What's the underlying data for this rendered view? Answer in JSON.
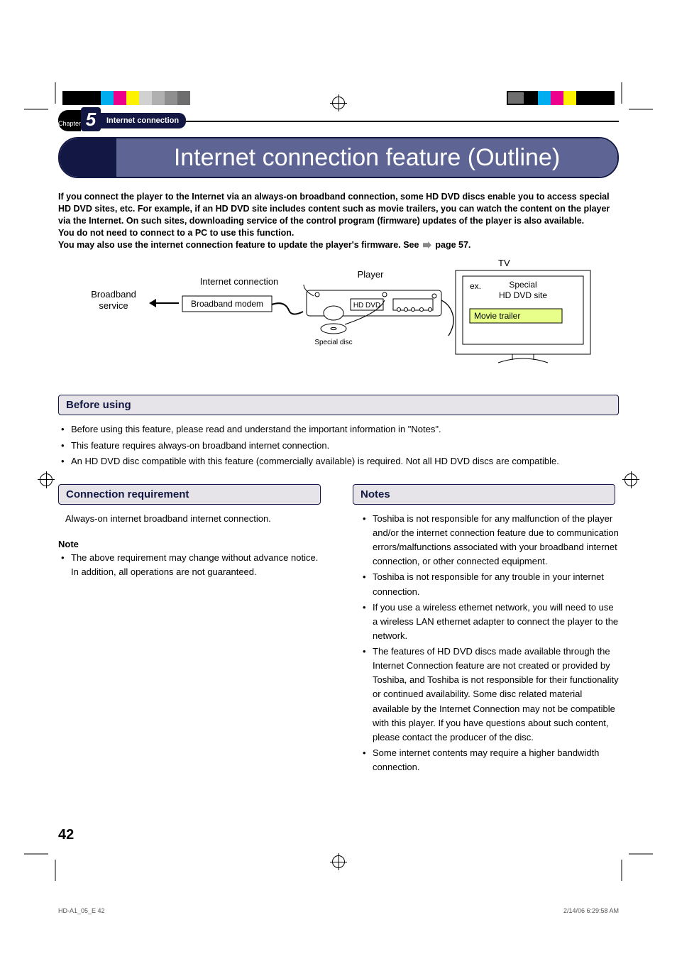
{
  "chapter": {
    "label_prefix": "Chapter",
    "number": "5",
    "section": "Internet connection"
  },
  "title": "Internet connection feature (Outline)",
  "intro": {
    "p1": "If you connect the player to the Internet via an always-on broadband connection, some HD DVD discs enable you to access special HD DVD sites, etc. For example, if an HD DVD site includes content such as movie trailers, you can watch the content on the player via the Internet. On such sites, downloading service of the control program (firmware) updates of the player is also available.",
    "p2": "You do not need to connect to a PC to use this function.",
    "p3_a": "You may also use the internet connection feature to update the player's firmware. See ",
    "p3_b": " page 57."
  },
  "diagram": {
    "broadband_service": "Broadband\nservice",
    "internet_connection": "Internet connection",
    "broadband_modem": "Broadband modem",
    "player": "Player",
    "hd_dvd": "HD DVD",
    "special_disc": "Special disc",
    "tv": "TV",
    "ex": "ex.",
    "special_site": "Special\nHD DVD site",
    "movie_trailer": "Movie trailer"
  },
  "before_using": {
    "heading": "Before using",
    "items": [
      "Before using this feature, please read and understand the important information in \"Notes\".",
      "This feature requires always-on broadband internet connection.",
      "An HD DVD disc compatible with this feature (commercially available) is required. Not all HD DVD discs are compatible."
    ]
  },
  "conn_req": {
    "heading": "Connection requirement",
    "body": "Always-on internet broadband internet connection.",
    "note_label": "Note",
    "note_item": "The above requirement may change without advance notice. In addition, all operations are not guaranteed."
  },
  "notes": {
    "heading": "Notes",
    "items": [
      "Toshiba is not responsible for any malfunction of the player and/or the internet connection feature due to communication errors/malfunctions associated with your broadband internet connection, or other connected equipment.",
      "Toshiba is not responsible for any trouble in your internet connection.",
      "If you use a wireless ethernet network, you will need to use a wireless LAN ethernet adapter to connect the player to the network.",
      "The features of HD DVD discs made available through the Internet Connection feature are not created or provided by Toshiba, and Toshiba is not responsible for their functionality or continued availability. Some disc related material available by the Internet Connection may not be compatible with this player. If you have questions about such content, please contact the producer of the disc.",
      "Some internet contents may require a higher bandwidth connection."
    ]
  },
  "page_number": "42",
  "footer": {
    "file": "HD-A1_05_E   42",
    "timestamp": "2/14/06   6:29:58 AM"
  },
  "colors": {
    "bar": [
      "#00adef",
      "#ec008c",
      "#fff200",
      "#808285",
      "#000000",
      "#00adef",
      "#ec008c",
      "#fff200",
      "#ffffff"
    ]
  }
}
